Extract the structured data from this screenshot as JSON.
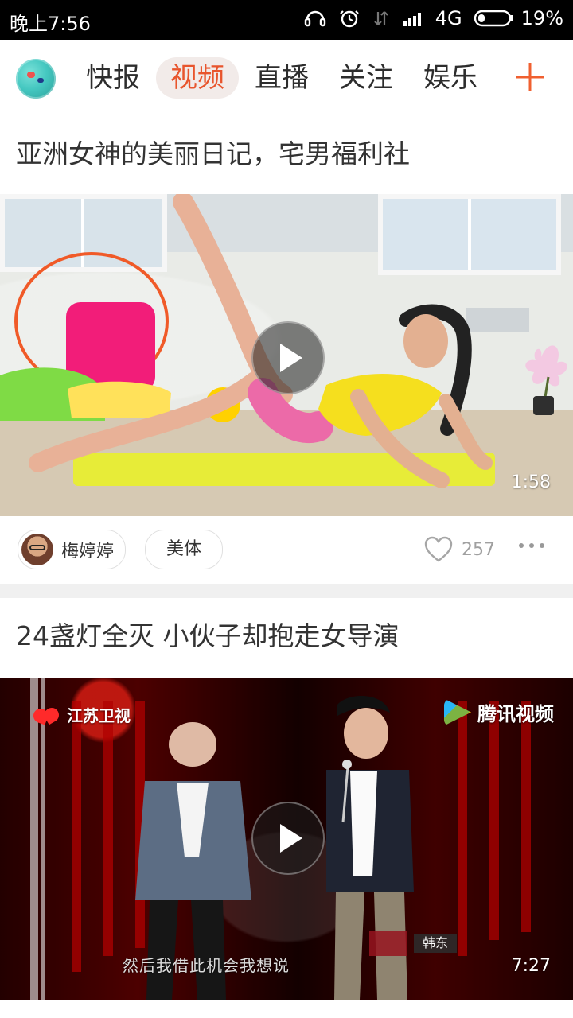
{
  "status": {
    "time": "晚上7:56",
    "network": "4G",
    "battery": "19%"
  },
  "nav": {
    "tabs": [
      "快报",
      "视频",
      "直播",
      "关注",
      "娱乐"
    ]
  },
  "feed": [
    {
      "title": "亚洲女神的美丽日记，宅男福利社",
      "duration": "1:58",
      "author": "梅婷婷",
      "tag": "美体",
      "likes": "257"
    },
    {
      "title": "24盏灯全灭 小伙子却抱走女导演",
      "duration": "7:27",
      "channel": "江苏卫视",
      "brand": "腾讯视频",
      "caption": "然后我借此机会我想说",
      "name_tag": "韩东"
    }
  ]
}
